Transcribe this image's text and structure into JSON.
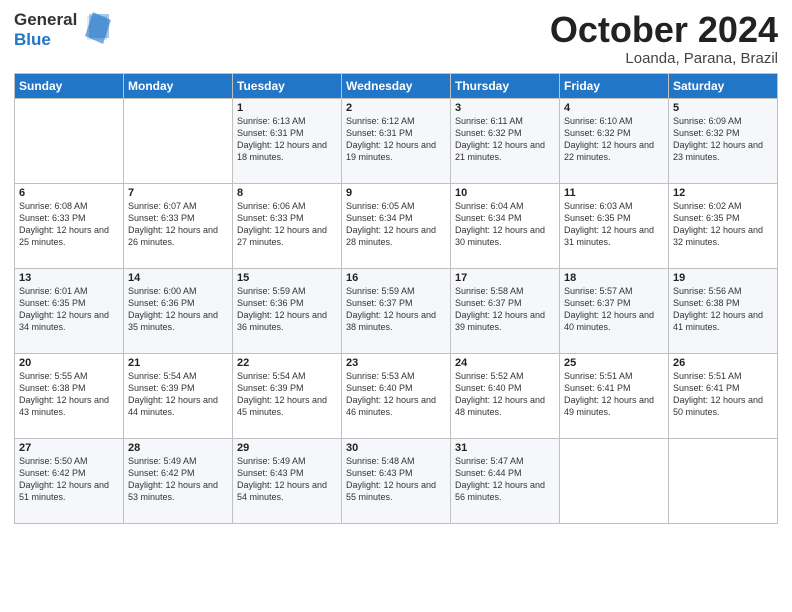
{
  "header": {
    "logo_general": "General",
    "logo_blue": "Blue",
    "month_title": "October 2024",
    "location": "Loanda, Parana, Brazil"
  },
  "days_of_week": [
    "Sunday",
    "Monday",
    "Tuesday",
    "Wednesday",
    "Thursday",
    "Friday",
    "Saturday"
  ],
  "weeks": [
    [
      {
        "day": "",
        "content": ""
      },
      {
        "day": "",
        "content": ""
      },
      {
        "day": "1",
        "content": "Sunrise: 6:13 AM\nSunset: 6:31 PM\nDaylight: 12 hours and 18 minutes."
      },
      {
        "day": "2",
        "content": "Sunrise: 6:12 AM\nSunset: 6:31 PM\nDaylight: 12 hours and 19 minutes."
      },
      {
        "day": "3",
        "content": "Sunrise: 6:11 AM\nSunset: 6:32 PM\nDaylight: 12 hours and 21 minutes."
      },
      {
        "day": "4",
        "content": "Sunrise: 6:10 AM\nSunset: 6:32 PM\nDaylight: 12 hours and 22 minutes."
      },
      {
        "day": "5",
        "content": "Sunrise: 6:09 AM\nSunset: 6:32 PM\nDaylight: 12 hours and 23 minutes."
      }
    ],
    [
      {
        "day": "6",
        "content": "Sunrise: 6:08 AM\nSunset: 6:33 PM\nDaylight: 12 hours and 25 minutes."
      },
      {
        "day": "7",
        "content": "Sunrise: 6:07 AM\nSunset: 6:33 PM\nDaylight: 12 hours and 26 minutes."
      },
      {
        "day": "8",
        "content": "Sunrise: 6:06 AM\nSunset: 6:33 PM\nDaylight: 12 hours and 27 minutes."
      },
      {
        "day": "9",
        "content": "Sunrise: 6:05 AM\nSunset: 6:34 PM\nDaylight: 12 hours and 28 minutes."
      },
      {
        "day": "10",
        "content": "Sunrise: 6:04 AM\nSunset: 6:34 PM\nDaylight: 12 hours and 30 minutes."
      },
      {
        "day": "11",
        "content": "Sunrise: 6:03 AM\nSunset: 6:35 PM\nDaylight: 12 hours and 31 minutes."
      },
      {
        "day": "12",
        "content": "Sunrise: 6:02 AM\nSunset: 6:35 PM\nDaylight: 12 hours and 32 minutes."
      }
    ],
    [
      {
        "day": "13",
        "content": "Sunrise: 6:01 AM\nSunset: 6:35 PM\nDaylight: 12 hours and 34 minutes."
      },
      {
        "day": "14",
        "content": "Sunrise: 6:00 AM\nSunset: 6:36 PM\nDaylight: 12 hours and 35 minutes."
      },
      {
        "day": "15",
        "content": "Sunrise: 5:59 AM\nSunset: 6:36 PM\nDaylight: 12 hours and 36 minutes."
      },
      {
        "day": "16",
        "content": "Sunrise: 5:59 AM\nSunset: 6:37 PM\nDaylight: 12 hours and 38 minutes."
      },
      {
        "day": "17",
        "content": "Sunrise: 5:58 AM\nSunset: 6:37 PM\nDaylight: 12 hours and 39 minutes."
      },
      {
        "day": "18",
        "content": "Sunrise: 5:57 AM\nSunset: 6:37 PM\nDaylight: 12 hours and 40 minutes."
      },
      {
        "day": "19",
        "content": "Sunrise: 5:56 AM\nSunset: 6:38 PM\nDaylight: 12 hours and 41 minutes."
      }
    ],
    [
      {
        "day": "20",
        "content": "Sunrise: 5:55 AM\nSunset: 6:38 PM\nDaylight: 12 hours and 43 minutes."
      },
      {
        "day": "21",
        "content": "Sunrise: 5:54 AM\nSunset: 6:39 PM\nDaylight: 12 hours and 44 minutes."
      },
      {
        "day": "22",
        "content": "Sunrise: 5:54 AM\nSunset: 6:39 PM\nDaylight: 12 hours and 45 minutes."
      },
      {
        "day": "23",
        "content": "Sunrise: 5:53 AM\nSunset: 6:40 PM\nDaylight: 12 hours and 46 minutes."
      },
      {
        "day": "24",
        "content": "Sunrise: 5:52 AM\nSunset: 6:40 PM\nDaylight: 12 hours and 48 minutes."
      },
      {
        "day": "25",
        "content": "Sunrise: 5:51 AM\nSunset: 6:41 PM\nDaylight: 12 hours and 49 minutes."
      },
      {
        "day": "26",
        "content": "Sunrise: 5:51 AM\nSunset: 6:41 PM\nDaylight: 12 hours and 50 minutes."
      }
    ],
    [
      {
        "day": "27",
        "content": "Sunrise: 5:50 AM\nSunset: 6:42 PM\nDaylight: 12 hours and 51 minutes."
      },
      {
        "day": "28",
        "content": "Sunrise: 5:49 AM\nSunset: 6:42 PM\nDaylight: 12 hours and 53 minutes."
      },
      {
        "day": "29",
        "content": "Sunrise: 5:49 AM\nSunset: 6:43 PM\nDaylight: 12 hours and 54 minutes."
      },
      {
        "day": "30",
        "content": "Sunrise: 5:48 AM\nSunset: 6:43 PM\nDaylight: 12 hours and 55 minutes."
      },
      {
        "day": "31",
        "content": "Sunrise: 5:47 AM\nSunset: 6:44 PM\nDaylight: 12 hours and 56 minutes."
      },
      {
        "day": "",
        "content": ""
      },
      {
        "day": "",
        "content": ""
      }
    ]
  ]
}
